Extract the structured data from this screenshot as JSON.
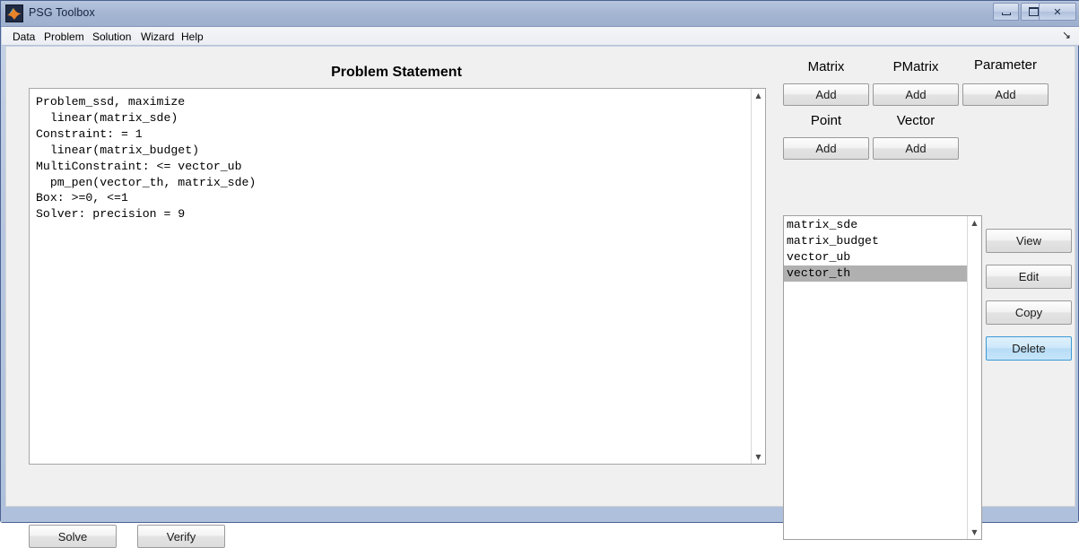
{
  "window": {
    "title": "PSG Toolbox",
    "icon": "matlab-membrane-icon",
    "controls": {
      "minimize": "minimize-icon",
      "maximize": "maximize-icon",
      "close": "✕"
    }
  },
  "menubar": {
    "items": [
      {
        "label": "Data"
      },
      {
        "label": "Problem"
      },
      {
        "label": "Solution"
      },
      {
        "label": "Wizard"
      },
      {
        "label": "Help"
      }
    ],
    "dock_glyph": "↘"
  },
  "problem_panel": {
    "title": "Problem Statement",
    "statement": "Problem_ssd, maximize\n  linear(matrix_sde)\nConstraint: = 1\n  linear(matrix_budget)\nMultiConstraint: <= vector_ub\n  pm_pen(vector_th, matrix_sde)\nBox: >=0, <=1\nSolver: precision = 9",
    "scrollbar": {
      "up_arrow": "▲",
      "down_arrow": "▼"
    },
    "actions": [
      {
        "label": "Solve"
      },
      {
        "label": "Verify"
      }
    ]
  },
  "data_panel": {
    "groups": [
      {
        "label": "Matrix",
        "button": "Add"
      },
      {
        "label": "PMatrix",
        "button": "Add"
      },
      {
        "label": "Parameter",
        "button": "Add"
      },
      {
        "label": "Point",
        "button": "Add"
      },
      {
        "label": "Vector",
        "button": "Add"
      }
    ],
    "list": {
      "items": [
        {
          "label": "matrix_sde",
          "selected": false
        },
        {
          "label": "matrix_budget",
          "selected": false
        },
        {
          "label": "vector_ub",
          "selected": false
        },
        {
          "label": "vector_th",
          "selected": true
        }
      ],
      "scrollbar": {
        "up_arrow": "▲",
        "down_arrow": "▼"
      }
    },
    "actions": [
      {
        "label": "View",
        "focused": false
      },
      {
        "label": "Edit",
        "focused": false
      },
      {
        "label": "Copy",
        "focused": false
      },
      {
        "label": "Delete",
        "focused": true
      }
    ]
  },
  "colors": {
    "titlebar": "#a3b4d1",
    "window_border": "#4b6394",
    "panel_bg": "#f0f0f0",
    "selection": "#b0b0b0",
    "focus_blue": "#3c9ad6"
  }
}
